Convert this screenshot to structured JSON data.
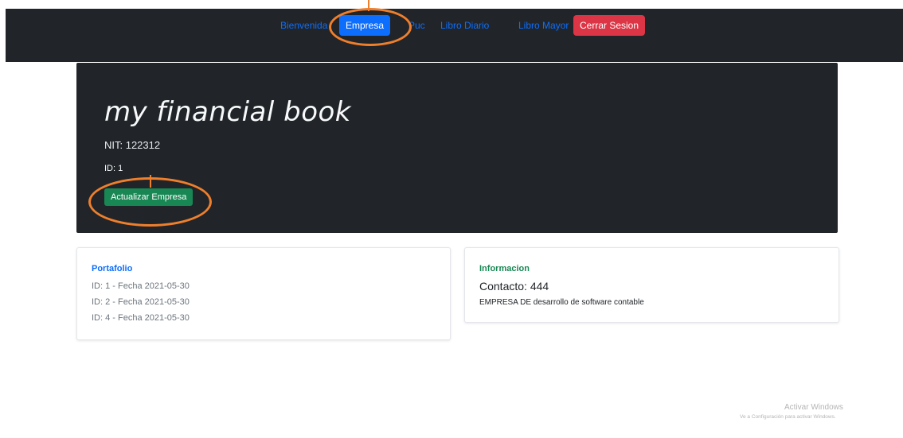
{
  "navbar": {
    "items": [
      {
        "label": "Bienvenida",
        "state": "normal"
      },
      {
        "label": "Empresa",
        "state": "active"
      },
      {
        "label": "Puc",
        "state": "normal"
      },
      {
        "label": "Libro Diario",
        "state": "normal"
      },
      {
        "label": "Libro Mayor",
        "state": "normal"
      }
    ],
    "logout_label": "Cerrar Sesion"
  },
  "hero": {
    "title": "my financial book",
    "nit": "NIT: 122312",
    "id": "ID: 1",
    "update_button_label": "Actualizar Empresa"
  },
  "portfolio": {
    "title": "Portafolio",
    "items": [
      "ID: 1 - Fecha 2021-05-30",
      "ID: 2 - Fecha 2021-05-30",
      "ID: 4 - Fecha 2021-05-30"
    ]
  },
  "info": {
    "title": "Informacion",
    "contact": "Contacto: 444",
    "description": "EMPRESA DE desarrollo de software contable"
  },
  "watermark": {
    "title": "Activar Windows",
    "subtitle": "Ve a Configuración para activar Windows."
  },
  "colors": {
    "dark": "#212529",
    "primary": "#0d6efd",
    "danger": "#dc3545",
    "success": "#198754",
    "annotation": "#f07f2c"
  }
}
